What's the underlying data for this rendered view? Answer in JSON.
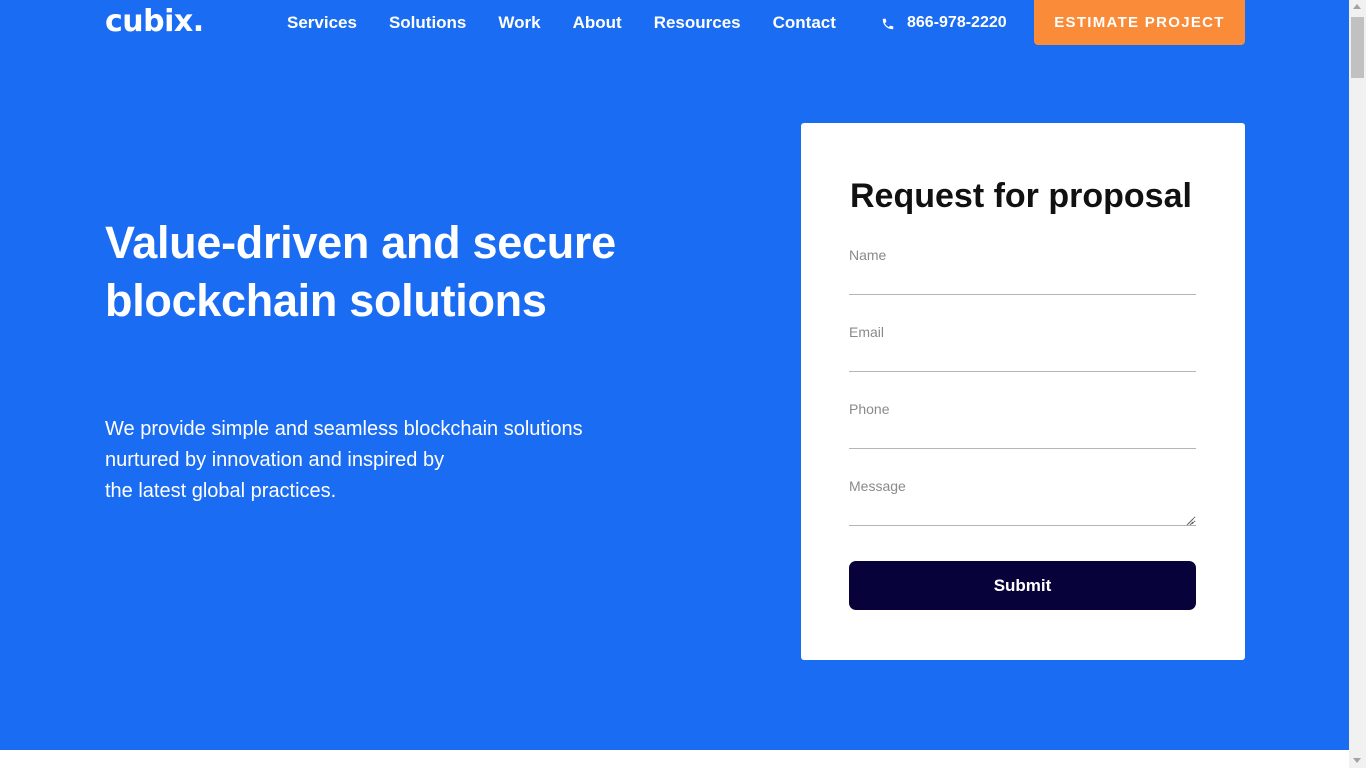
{
  "brand": {
    "logo": "cubix."
  },
  "nav": {
    "items": [
      {
        "label": "Services"
      },
      {
        "label": "Solutions"
      },
      {
        "label": "Work"
      },
      {
        "label": "About"
      },
      {
        "label": "Resources"
      },
      {
        "label": "Contact"
      }
    ]
  },
  "header": {
    "phone": "866-978-2220",
    "cta_label": "ESTIMATE PROJECT"
  },
  "hero": {
    "headline": "Value-driven and secure blockchain solutions",
    "subtext_lines": [
      "We provide simple and seamless blockchain solutions",
      "nurtured by innovation and inspired by",
      "the latest global practices."
    ]
  },
  "form": {
    "title": "Request for proposal",
    "fields": [
      {
        "label": "Name",
        "value": ""
      },
      {
        "label": "Email",
        "value": ""
      },
      {
        "label": "Phone",
        "value": ""
      },
      {
        "label": "Message",
        "value": ""
      }
    ],
    "submit_label": "Submit"
  },
  "colors": {
    "hero_bg": "#1a6cf2",
    "cta_bg": "#f98b39",
    "submit_bg": "#07033a"
  },
  "icons": {
    "phone": "phone-icon"
  }
}
